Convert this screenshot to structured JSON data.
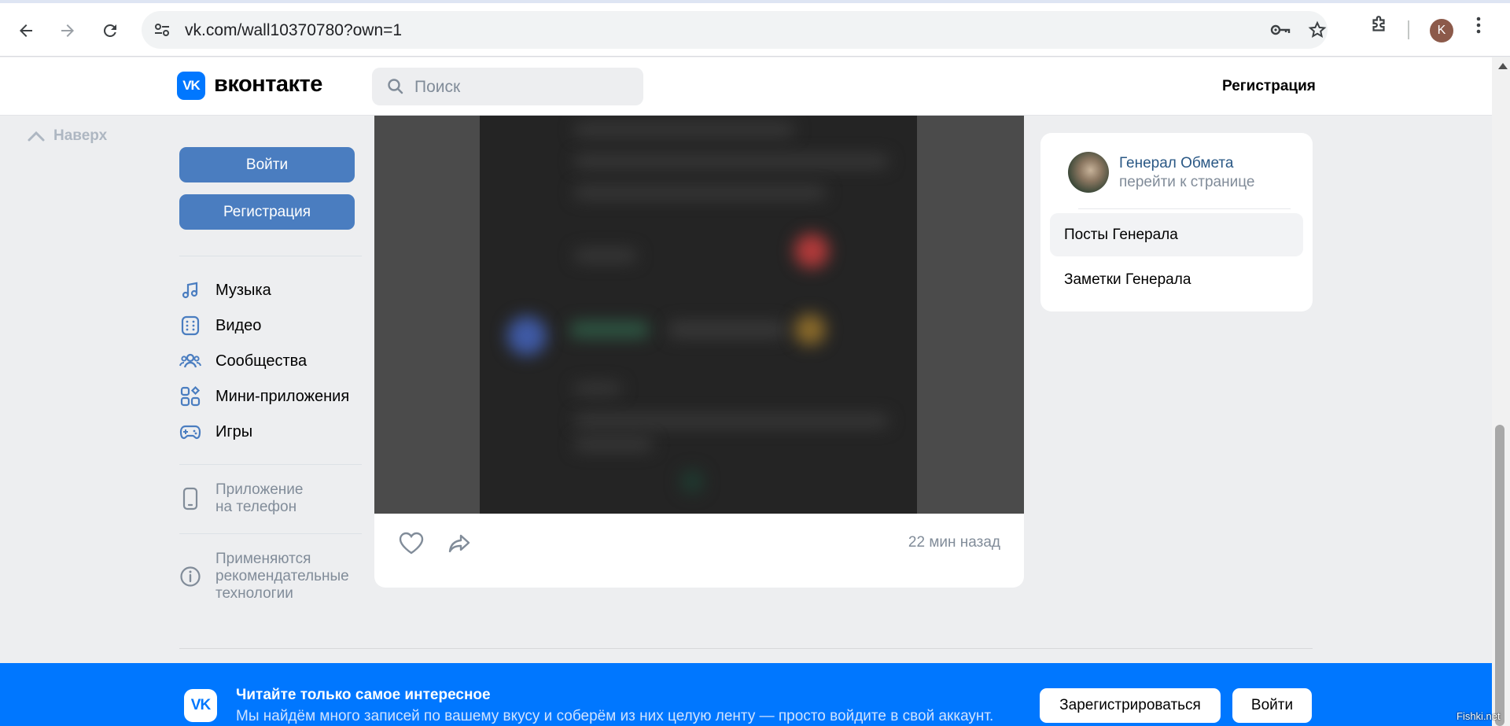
{
  "browser": {
    "url": "vk.com/wall10370780?own=1",
    "profile_initial": "K"
  },
  "header": {
    "logo_text": "вконтакте",
    "logo_mark": "VK",
    "search_placeholder": "Поиск",
    "register_link": "Регистрация"
  },
  "up_link": "Наверх",
  "sidebar": {
    "login_button": "Войти",
    "register_button": "Регистрация",
    "menu": [
      {
        "label": "Музыка",
        "icon": "music-icon"
      },
      {
        "label": "Видео",
        "icon": "video-icon"
      },
      {
        "label": "Сообщества",
        "icon": "communities-icon"
      },
      {
        "label": "Мини-приложения",
        "icon": "mini-apps-icon"
      },
      {
        "label": "Игры",
        "icon": "games-icon"
      }
    ],
    "app_line1": "Приложение",
    "app_line2": "на телефон",
    "rec_line1": "Применяются",
    "rec_line2": "рекомендательные",
    "rec_line3": "технологии"
  },
  "post": {
    "time": "22 мин назад"
  },
  "right_panel": {
    "name": "Генерал Обмета",
    "subtitle": "перейти к странице",
    "items": [
      {
        "label": "Посты Генерала",
        "active": true
      },
      {
        "label": "Заметки Генерала",
        "active": false
      }
    ]
  },
  "banner": {
    "title": "Читайте только самое интересное",
    "subtitle": "Мы найдём много записей по вашему вкусу и соберём из них целую ленту — просто войдите в свой аккаунт.",
    "register_button": "Зарегистрироваться",
    "login_button": "Войти"
  },
  "watermark": "Fishki.net",
  "colors": {
    "vk_blue": "#0077ff",
    "button_blue": "#4a7dc0",
    "link_blue": "#2a5885",
    "page_bg": "#edeef0"
  }
}
